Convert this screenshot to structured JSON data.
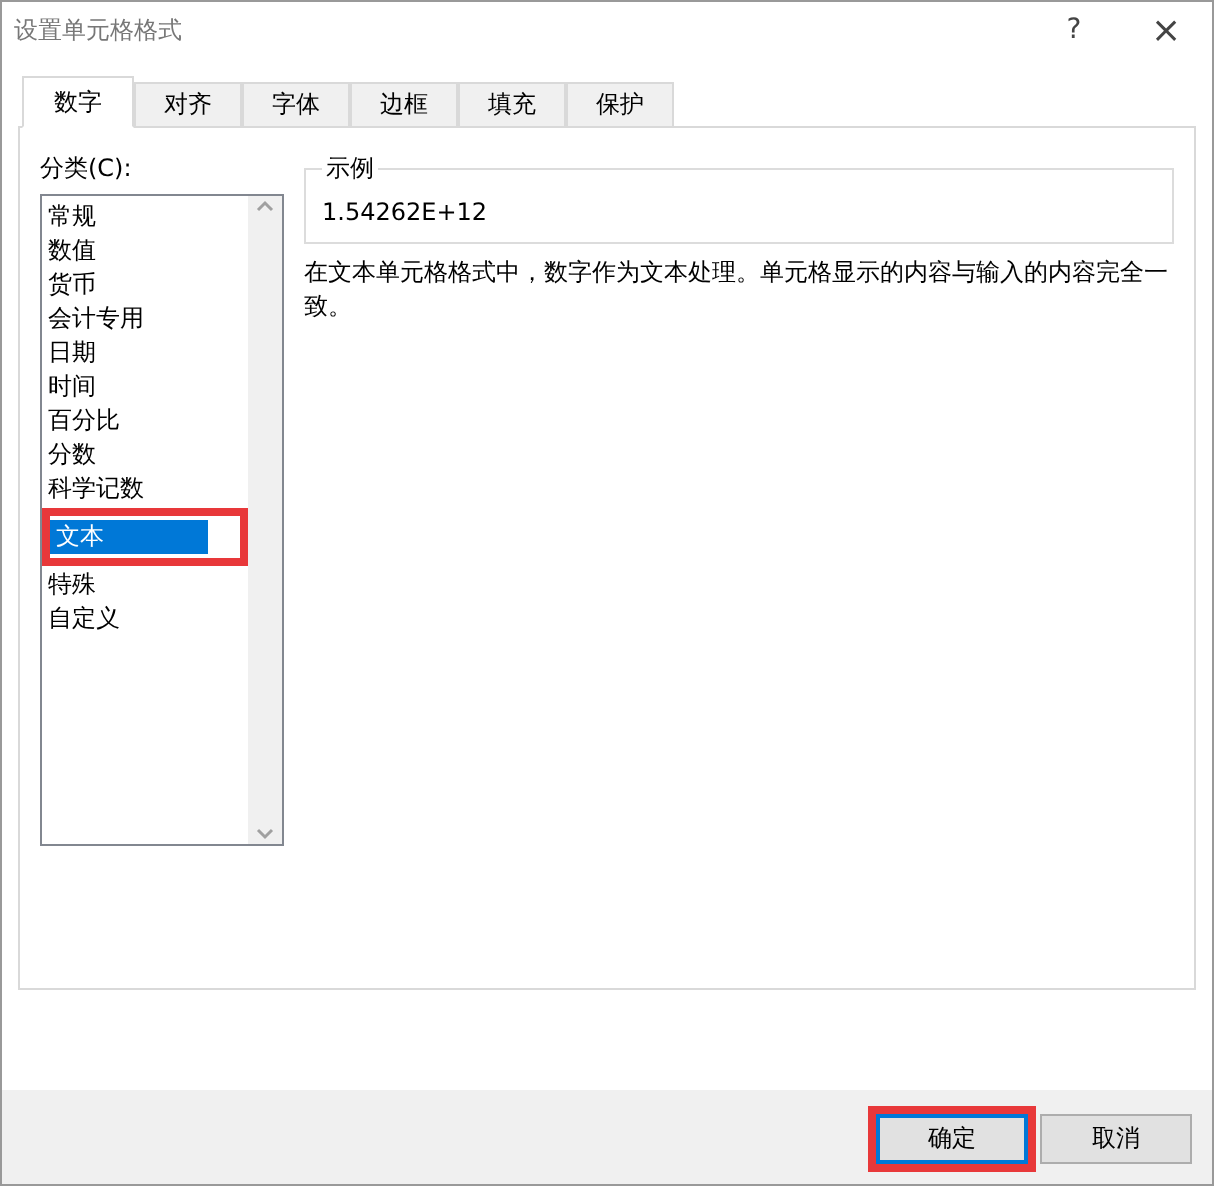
{
  "window": {
    "title": "设置单元格格式",
    "help": "?",
    "close": "×"
  },
  "tabs": [
    {
      "label": "数字",
      "selected": true
    },
    {
      "label": "对齐",
      "selected": false
    },
    {
      "label": "字体",
      "selected": false
    },
    {
      "label": "边框",
      "selected": false
    },
    {
      "label": "填充",
      "selected": false
    },
    {
      "label": "保护",
      "selected": false
    }
  ],
  "category": {
    "label": "分类(C):",
    "items": [
      {
        "label": "常规",
        "selected": false,
        "highlighted": false
      },
      {
        "label": "数值",
        "selected": false,
        "highlighted": false
      },
      {
        "label": "货币",
        "selected": false,
        "highlighted": false
      },
      {
        "label": "会计专用",
        "selected": false,
        "highlighted": false
      },
      {
        "label": "日期",
        "selected": false,
        "highlighted": false
      },
      {
        "label": "时间",
        "selected": false,
        "highlighted": false
      },
      {
        "label": "百分比",
        "selected": false,
        "highlighted": false
      },
      {
        "label": "分数",
        "selected": false,
        "highlighted": false
      },
      {
        "label": "科学记数",
        "selected": false,
        "highlighted": false
      },
      {
        "label": "文本",
        "selected": true,
        "highlighted": true
      },
      {
        "label": "特殊",
        "selected": false,
        "highlighted": false
      },
      {
        "label": "自定义",
        "selected": false,
        "highlighted": false
      }
    ]
  },
  "sample": {
    "label": "示例",
    "value": "1.54262E+12"
  },
  "description": "在文本单元格格式中，数字作为文本处理。单元格显示的内容与输入的内容完全一致。",
  "buttons": [
    {
      "label": "确定",
      "default": true,
      "highlighted": true
    },
    {
      "label": "取消",
      "default": false,
      "highlighted": false
    }
  ]
}
